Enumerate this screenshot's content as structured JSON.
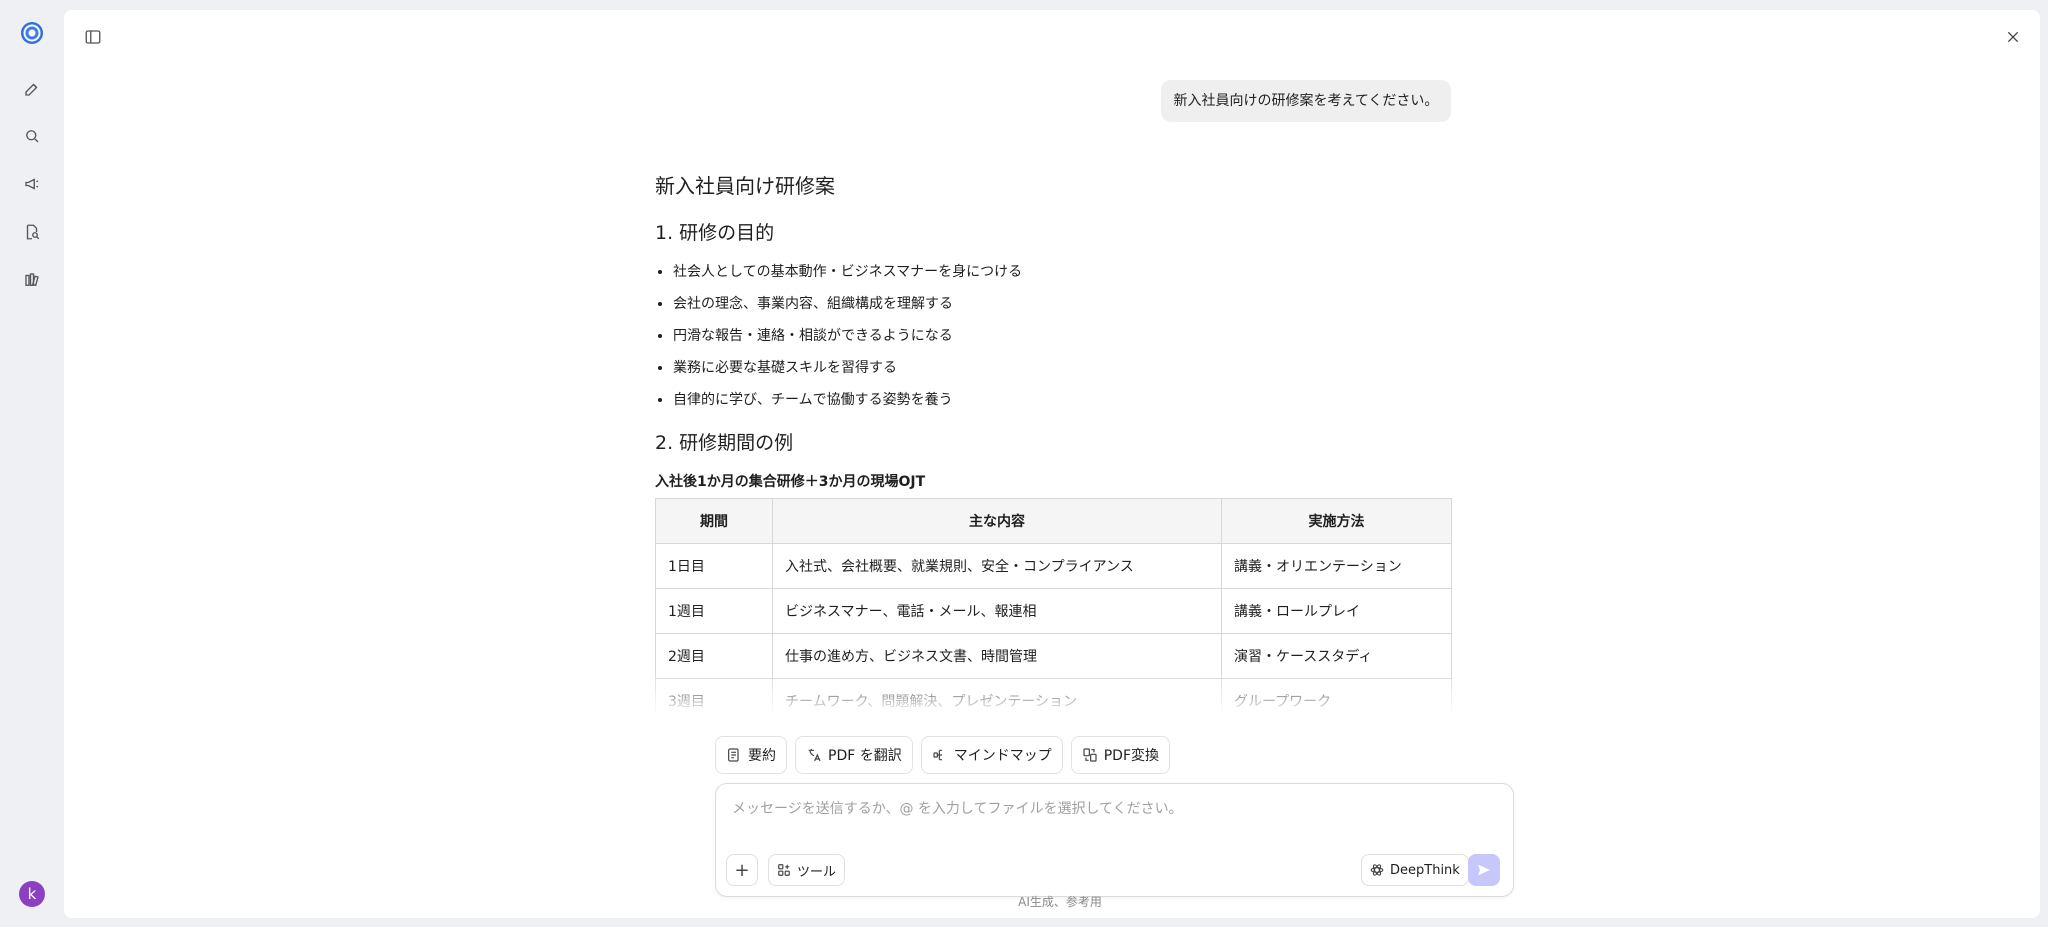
{
  "sidebar": {
    "logo": "whale-logo",
    "items": [
      {
        "icon": "new-chat-icon"
      },
      {
        "icon": "search-icon"
      },
      {
        "icon": "announcement-icon"
      },
      {
        "icon": "document-search-icon"
      },
      {
        "icon": "library-icon"
      }
    ],
    "avatar_initial": "k"
  },
  "chat": {
    "user_message": "新入社員向けの研修案を考えてください。",
    "answer": {
      "title": "新入社員向け研修案",
      "section1_title": "1. 研修の目的",
      "bullets": [
        "社会人としての基本動作・ビジネスマナーを身につける",
        "会社の理念、事業内容、組織構成を理解する",
        "円滑な報告・連絡・相談ができるようになる",
        "業務に必要な基礎スキルを習得する",
        "自律的に学び、チームで協働する姿勢を養う"
      ],
      "section2_title": "2. 研修期間の例",
      "period_note": "入社後1か月の集合研修＋3か月の現場OJT",
      "table": {
        "headers": [
          "期間",
          "主な内容",
          "実施方法"
        ],
        "rows": [
          [
            "1日目",
            "入社式、会社概要、就業規則、安全・コンプライアンス",
            "講義・オリエンテーション"
          ],
          [
            "1週目",
            "ビジネスマナー、電話・メール、報連相",
            "講義・ロールプレイ"
          ],
          [
            "2週目",
            "仕事の進め方、ビジネス文書、時間管理",
            "演習・ケーススタディ"
          ],
          [
            "3週目",
            "チームワーク、問題解決、プレゼンテーション",
            "グループワーク"
          ]
        ]
      }
    }
  },
  "quick_actions": [
    {
      "label": "要約",
      "icon": "summary-icon"
    },
    {
      "label": "PDF を翻訳",
      "icon": "translate-icon"
    },
    {
      "label": "マインドマップ",
      "icon": "mindmap-icon"
    },
    {
      "label": "PDF変換",
      "icon": "convert-icon"
    }
  ],
  "composer": {
    "placeholder": "メッセージを送信するか、@ を入力してファイルを選択してください。",
    "tools_label": "ツール",
    "deepthink_label": "DeepThink"
  },
  "footer_note": "AI生成、参考用",
  "colors": {
    "send_button": "#c8c7fb",
    "avatar": "#8d3fc2",
    "background": "#eef0f3"
  }
}
